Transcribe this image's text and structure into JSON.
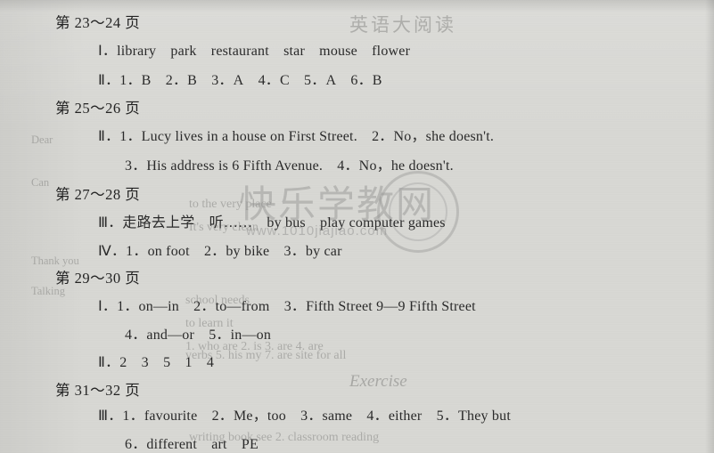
{
  "document": {
    "type": "answer-key-page",
    "language": "zh-CN/en",
    "background_color": "#d8d8d4",
    "text_color": "#2a2a2a"
  },
  "watermark": {
    "big_text": "快乐学教网",
    "small_text": "www.1010jiajiao.com"
  },
  "entries": [
    {
      "heading": "第 23～24 页",
      "lines": [
        "Ⅰ．library park restaurant star mouse flower",
        "Ⅱ．1．B 2．B 3．A 4．C 5．A 6．B"
      ]
    },
    {
      "heading": "第 25～26 页",
      "lines": [
        "Ⅱ．1．Lucy lives in a house on First Street. 2．No，she doesn't.",
        "3．His address is 6 Fifth Avenue. 4．No，he doesn't."
      ]
    },
    {
      "heading": "第 27～28 页",
      "lines": [
        "Ⅲ．走路去上学 听…… by bus play computer games",
        "Ⅳ．1．on foot 2．by bike 3．by car"
      ]
    },
    {
      "heading": "第 29～30 页",
      "lines": [
        "Ⅰ．1．on—in 2．to—from 3．Fifth Street 9—9 Fifth Street",
        "4．and—or 5．in—on",
        "Ⅱ．2 3 5 1 4"
      ]
    },
    {
      "heading": "第 31～32 页",
      "lines": [
        "Ⅲ．1．favourite 2．Me，too 3．same 4．either 5．They but",
        "6．different art PE"
      ]
    }
  ],
  "ghost_text": {
    "title": "英语大阅读",
    "cursive": "Exercise",
    "fragments": [
      "Dear",
      "Can",
      "to the very place",
      "It's very clean",
      "Thank you",
      "Talking",
      "school needs",
      "to learn it",
      "1. who are 2. is 3. are 4. are",
      "verbs 5. his my 7. are site for all",
      "writing book  see 2. classroom  reading"
    ]
  }
}
